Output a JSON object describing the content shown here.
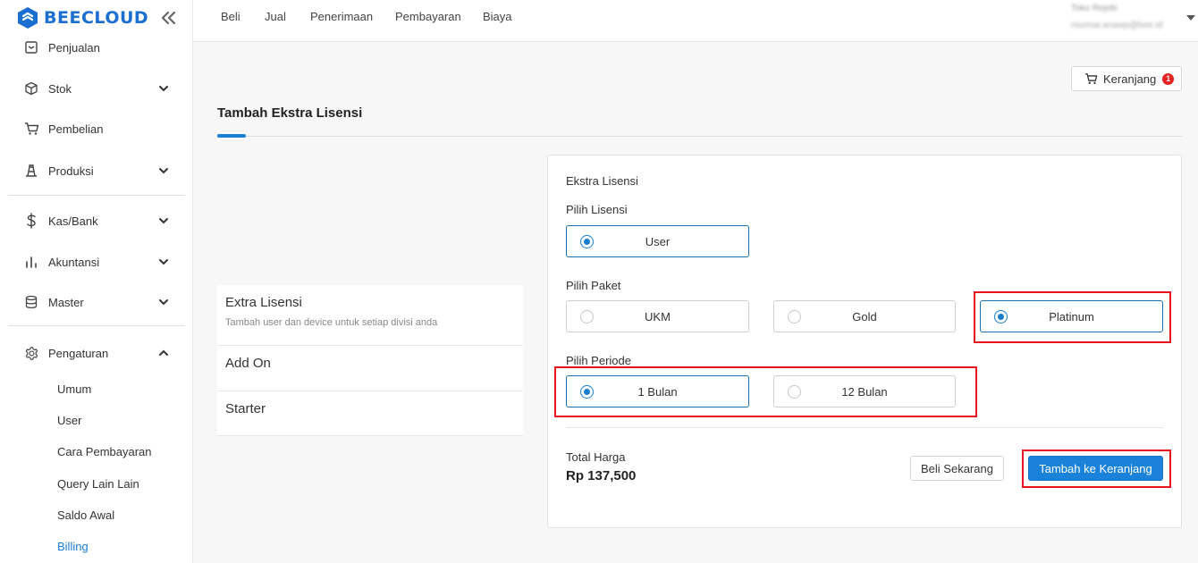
{
  "brand": {
    "name": "BEECLOUD",
    "accent": "#1a7ed0",
    "highlight": "#e8141f"
  },
  "sidebar": {
    "items": [
      {
        "label": "Penjualan",
        "icon": "sales-icon"
      },
      {
        "label": "Stok",
        "icon": "box-icon",
        "expandable": true
      },
      {
        "label": "Pembelian",
        "icon": "cart-icon"
      },
      {
        "label": "Produksi",
        "icon": "production-icon",
        "expandable": true
      },
      {
        "label": "Kas/Bank",
        "icon": "dollar-icon",
        "expandable": true
      },
      {
        "label": "Akuntansi",
        "icon": "bar-chart-icon",
        "expandable": true
      },
      {
        "label": "Master",
        "icon": "database-icon",
        "expandable": true
      },
      {
        "label": "Pengaturan",
        "icon": "gear-icon",
        "expanded": true
      }
    ],
    "subitems": [
      {
        "label": "Umum"
      },
      {
        "label": "User"
      },
      {
        "label": "Cara Pembayaran"
      },
      {
        "label": "Query Lain Lain"
      },
      {
        "label": "Saldo Awal"
      },
      {
        "label": "Billing",
        "active": true
      }
    ]
  },
  "topnav": [
    "Beli",
    "Jual",
    "Penerimaan",
    "Pembayaran",
    "Biaya"
  ],
  "user": {
    "name": "Toko Rejeki",
    "email": "risomar.anawp@bee.id"
  },
  "cart": {
    "label": "Keranjang",
    "count": "1"
  },
  "page": {
    "title": "Tambah Ekstra Lisensi"
  },
  "left_list": [
    {
      "title": "Extra Lisensi",
      "desc": "Tambah user dan device untuk setiap divisi anda"
    },
    {
      "title": "Add On"
    },
    {
      "title": "Starter"
    }
  ],
  "form": {
    "section": "Ekstra Lisensi",
    "license_label": "Pilih Lisensi",
    "license_options": [
      {
        "label": "User",
        "selected": true
      }
    ],
    "package_label": "Pilih Paket",
    "package_options": [
      {
        "label": "UKM",
        "selected": false
      },
      {
        "label": "Gold",
        "selected": false
      },
      {
        "label": "Platinum",
        "selected": true
      }
    ],
    "period_label": "Pilih Periode",
    "period_options": [
      {
        "label": "1 Bulan",
        "selected": true
      },
      {
        "label": "12 Bulan",
        "selected": false
      }
    ],
    "total_label": "Total Harga",
    "total_value": "Rp 137,500",
    "buy_now": "Beli Sekarang",
    "add_to_cart": "Tambah ke Keranjang"
  }
}
